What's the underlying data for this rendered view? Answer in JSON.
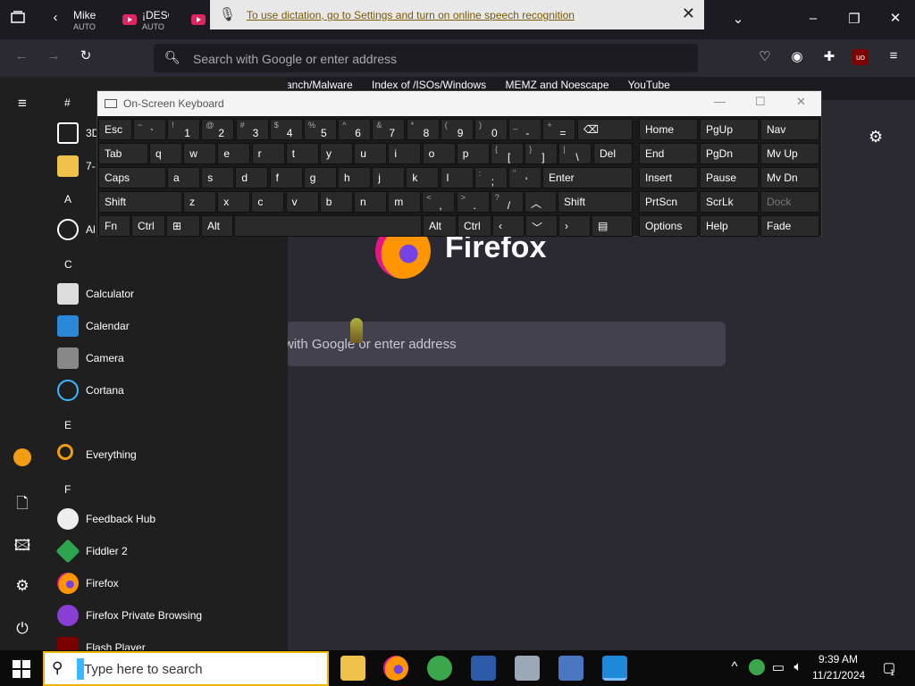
{
  "tabs": [
    {
      "title": "Mike",
      "subtitle": "AUTO"
    },
    {
      "title": "¡DESC",
      "subtitle": "AUTO"
    }
  ],
  "dictation": {
    "message": "To use dictation, go to Settings and turn on online speech recognition"
  },
  "urlbar": {
    "placeholder": "Search with Google or enter address"
  },
  "bookmarks": [
    "anch/Malware",
    "Index of /ISOs/Windows",
    "MEMZ and Noescape",
    "YouTube"
  ],
  "newtab": {
    "brand": "Firefox",
    "search_placeholder": "with Google or enter address"
  },
  "start_menu": {
    "letters": [
      "#",
      "A",
      "C",
      "E",
      "F"
    ],
    "apps": [
      "3D",
      "7-",
      "Al",
      "Calculator",
      "Calendar",
      "Camera",
      "Cortana",
      "Everything",
      "Feedback Hub",
      "Fiddler 2",
      "Firefox",
      "Firefox Private Browsing",
      "Flash Player"
    ]
  },
  "osk": {
    "title": "On-Screen Keyboard",
    "keys": {
      "esc": "Esc",
      "tab": "Tab",
      "caps": "Caps",
      "shift": "Shift",
      "fn": "Fn",
      "ctrl": "Ctrl",
      "alt": "Alt",
      "enter": "Enter",
      "del": "Del",
      "shift_r": "Shift",
      "alt_r": "Alt",
      "ctrl_r": "Ctrl",
      "home": "Home",
      "pgup": "PgUp",
      "nav": "Nav",
      "end": "End",
      "pgdn": "PgDn",
      "mvup": "Mv Up",
      "insert": "Insert",
      "pause": "Pause",
      "mvdn": "Mv Dn",
      "prtscn": "PrtScn",
      "scrlk": "ScrLk",
      "dock": "Dock",
      "options": "Options",
      "help": "Help",
      "fade": "Fade"
    },
    "row1": [
      [
        "~",
        "`"
      ],
      [
        "!",
        "1"
      ],
      [
        "@",
        "2"
      ],
      [
        "#",
        "3"
      ],
      [
        "$",
        "4"
      ],
      [
        "%",
        "5"
      ],
      [
        "^",
        "6"
      ],
      [
        "&",
        "7"
      ],
      [
        "*",
        "8"
      ],
      [
        "(",
        "9"
      ],
      [
        ")",
        "0"
      ],
      [
        "_",
        "-"
      ],
      [
        "+",
        "="
      ]
    ],
    "row2": [
      "q",
      "w",
      "e",
      "r",
      "t",
      "y",
      "u",
      "i",
      "o",
      "p",
      [
        "{",
        "["
      ],
      [
        "}",
        "]"
      ],
      [
        "|",
        "\\"
      ]
    ],
    "row3": [
      "a",
      "s",
      "d",
      "f",
      "g",
      "h",
      "j",
      "k",
      "l",
      [
        ":",
        ";"
      ],
      [
        "\"",
        "'"
      ]
    ],
    "row4": [
      "z",
      "x",
      "c",
      "v",
      "b",
      "n",
      "m",
      [
        "<",
        ","
      ],
      [
        ">",
        "."
      ],
      [
        "?",
        "/"
      ]
    ]
  },
  "taskbar": {
    "search_placeholder": "Type here to search",
    "time": "9:39 AM",
    "date": "11/21/2024",
    "notifications": "1"
  },
  "colors": {
    "accent": "#f0b400",
    "firefox_bg": "#2b2a33",
    "start_bg": "#1f1f1f"
  }
}
